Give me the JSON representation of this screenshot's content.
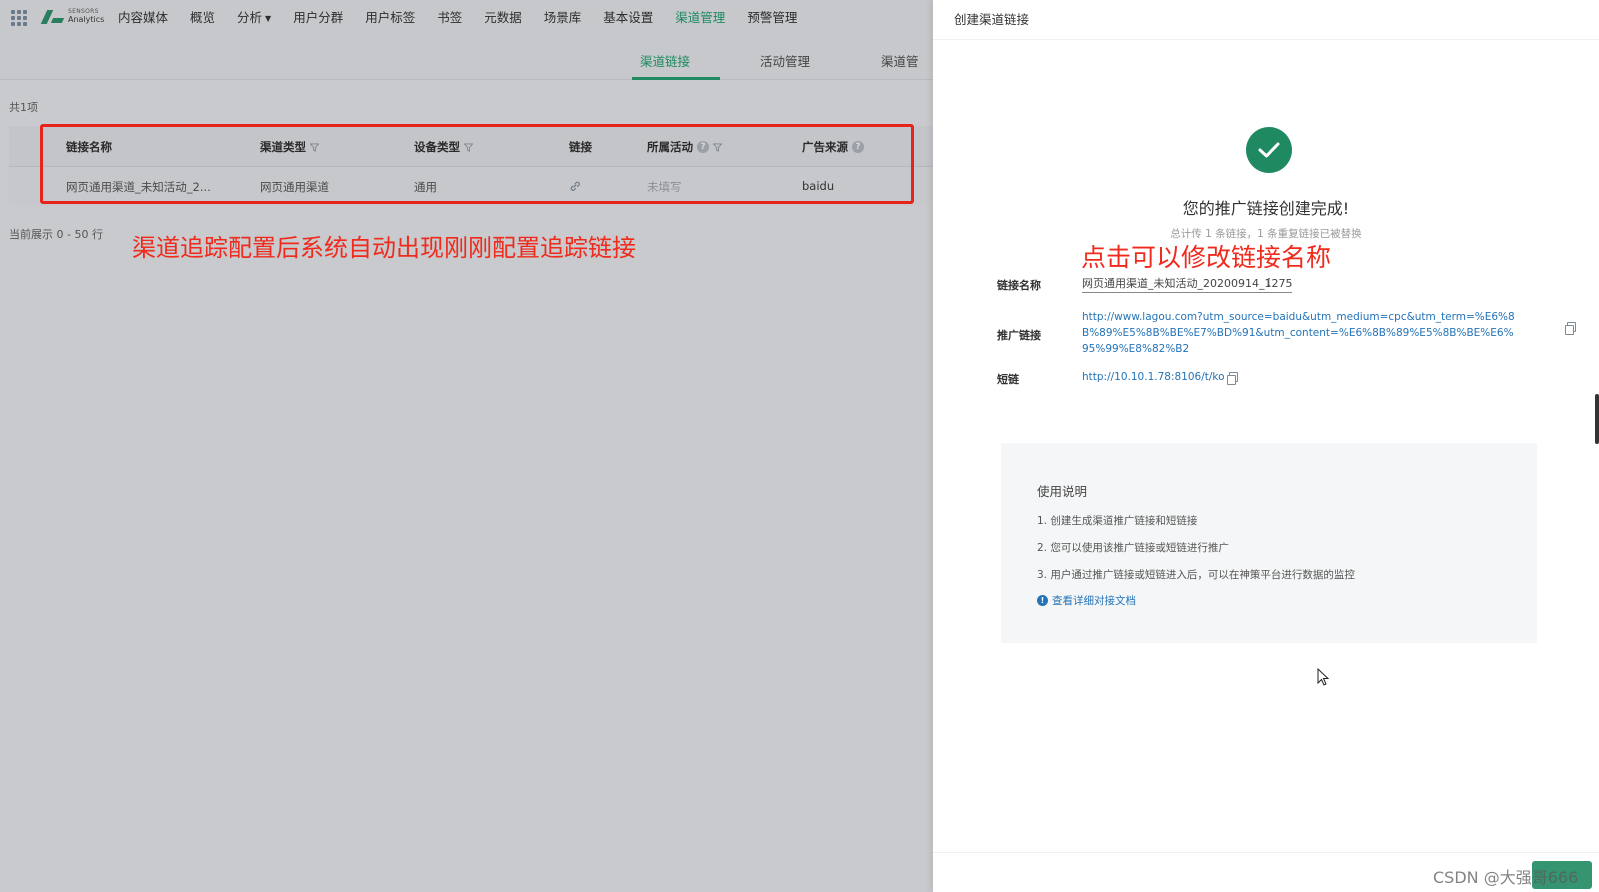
{
  "topnav": {
    "items": [
      "内容媒体",
      "概览",
      "分析",
      "用户分群",
      "用户标签",
      "书签",
      "元数据",
      "场景库",
      "基本设置",
      "渠道管理",
      "预警管理"
    ],
    "logo_line1": "SENSORS",
    "logo_line2": "Analytics"
  },
  "subtabs": [
    "渠道链接",
    "活动管理",
    "渠道管"
  ],
  "list": {
    "total": "共1项",
    "columns": [
      "链接名称",
      "渠道类型",
      "设备类型",
      "链接",
      "所属活动",
      "广告来源"
    ],
    "row": {
      "name": "网页通用渠道_未知活动_2...",
      "channel_type": "网页通用渠道",
      "device_type": "通用",
      "activity": "未填写",
      "ad_source": "baidu"
    },
    "range": "当前展示 0 - 50 行"
  },
  "annotations": {
    "left": "渠道追踪配置后系统自动出现刚刚配置追踪链接",
    "right": "点击可以修改链接名称"
  },
  "drawer": {
    "title": "创建渠道链接",
    "success_title": "您的推广链接创建完成!",
    "success_sub": "总计传 1 条链接，1 条重复链接已被替换",
    "fields": {
      "name_label": "链接名称",
      "name_value": "网页通用渠道_未知活动_20200914_1275",
      "promo_label": "推广链接",
      "promo_value": "http://www.lagou.com?utm_source=baidu&utm_medium=cpc&utm_term=%E6%8B%89%E5%8B%BE%E7%BD%91&utm_content=%E6%8B%89%E5%8B%BE%E6%95%99%E8%82%B2",
      "short_label": "短链",
      "short_value": "http://10.10.1.78:8106/t/ko"
    },
    "instructions": {
      "title": "使用说明",
      "items": [
        "1. 创建生成渠道推广链接和短链接",
        "2. 您可以使用该推广链接或短链进行推广",
        "3. 用户通过推广链接或短链进入后，可以在神策平台进行数据的监控"
      ],
      "doc_link": "查看详细对接文档"
    }
  },
  "watermark": "CSDN @大强哥666",
  "colors": {
    "brand": "#1f8a62",
    "link": "#2473b8",
    "annotation": "#f02a1c"
  },
  "icons": [
    "apps-grid-icon",
    "check-icon",
    "copy-icon",
    "filter-icon",
    "help-icon",
    "link-icon",
    "info-icon",
    "cursor-icon"
  ]
}
